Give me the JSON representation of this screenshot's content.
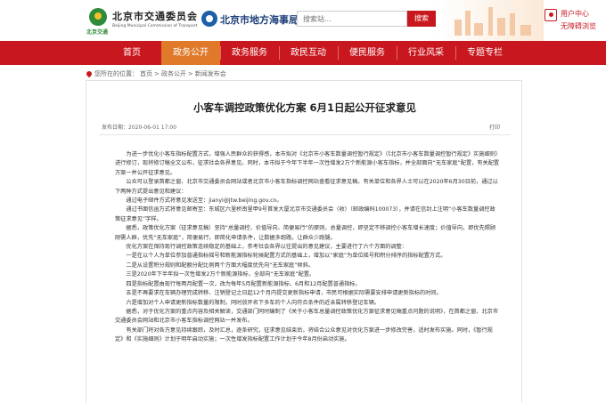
{
  "header": {
    "logo_caption": "北京交通",
    "org_name": "北京市交通委员会",
    "org_name_en": "Beijing Municipal Commission of Transport",
    "org_name_2": "北京市地方海事局",
    "search_placeholder": "搜索站...",
    "search_button": "搜索",
    "user_center": "用户中心",
    "barrier_free": "无障碍浏览"
  },
  "nav": {
    "items": [
      "首页",
      "政务公开",
      "政务服务",
      "政民互动",
      "便民服务",
      "行业风采",
      "专题专栏"
    ],
    "active_index": 1
  },
  "breadcrumb": [
    "您所在的位置：",
    "首页",
    ">",
    "政务公开",
    ">",
    "新闻发布会"
  ],
  "article": {
    "title": "小客车调控政策优化方案 6月1日起公开征求意见",
    "meta": "发布日期：2020-06-01 17:00",
    "print": "打印",
    "paragraphs": [
      "为进一步优化小客车指标配置方式，增强人民群众的获得感，本市拟对《北京市小客车数量调控暂行规定》（《北京市小客车数量调控暂行规定》实施细则）进行修订，现将修订稿全文公布，征求社会各界意见。同时，本市拟于今年下半年一次性增发2万个新能源小客车指标，并全部面向“无车家庭”配置，有关配置方案一并公开征求意见。",
      "公众可以登录首都之窗、北京市交通委员会网站或者北京市小客车指标调控网站查看征求意见稿。有关单位和各界人士可以在2020年6月30日前，通过以下两种方式提出意见和建议：",
      "通过电子邮件方式将意见发送至：jianyi@jtw.beijing.gov.cn。",
      "通过书面信函方式将意见邮寄至：东城区六里桥南里甲9号首发大厦北京市交通委员会（收）（邮政编码100073），并请在信封上注明“小客车数量调控政策征求意见”字样。",
      "据悉，政策优化方案（征求意见稿）坚持“总量调控、价值导向、简便易行”的原则，总量调控，即坚定不移调控小客车增长速度；价值导向，即优先照顾刚需人群，优先“无车家庭”，简便易行，即简化申请条件，让数据多跑路，让群众少跑腿。",
      "优化方案在保持现行调控政策连续稳定的基础上，参考社会各界以往提出的意见建议，主要进行了六个方面的调整：",
      "一是在以个人为单位参加普通指标摇号和新能源指标轮候配置方式的基础上，增加以“家庭”为单位摇号和积分排序的指标配置方式。",
      "二是从设置积分规则和配额分配比例两个方面大幅度优先向“无车家庭”倾斜。",
      "三是2020年下半年拟一次性增发2万个新能源指标，全部向“无车家庭”配置。",
      "四是指标配置由现行每两月配置一次，改为每年5月配置新能源指标、6月和12月配置普通指标。",
      "五是不再要求在车辆办理完成转移、注销登记之日起12个月内提交更新指标申请，市民可根据实际需要安排申请更新指标的时间。",
      "六是增加对个人申请更新指标数量的限制，同时放开名下多车的个人向符合条件的近亲属转移登记车辆。",
      "据悉，对于优化方案的重点内容及相关解读，交通部门同时编制了《关于小客车总量调控政策优化方案征求意见稿重点问题的说明》，在首都之窗、北京市交通委员会网站和北京市小客车指标调控网站一并发布。",
      "有关部门将对各方意见持续跟踪，及时汇总，逐条研究，征求意见结束后，将结合公众意见对优化方案进一步修改完善，适时发布实施。同时，《暂行规定》和《实施细则》计划于明年启动实施；一次性增发指标配置工作计划于今年8月份启动实施。"
    ]
  }
}
